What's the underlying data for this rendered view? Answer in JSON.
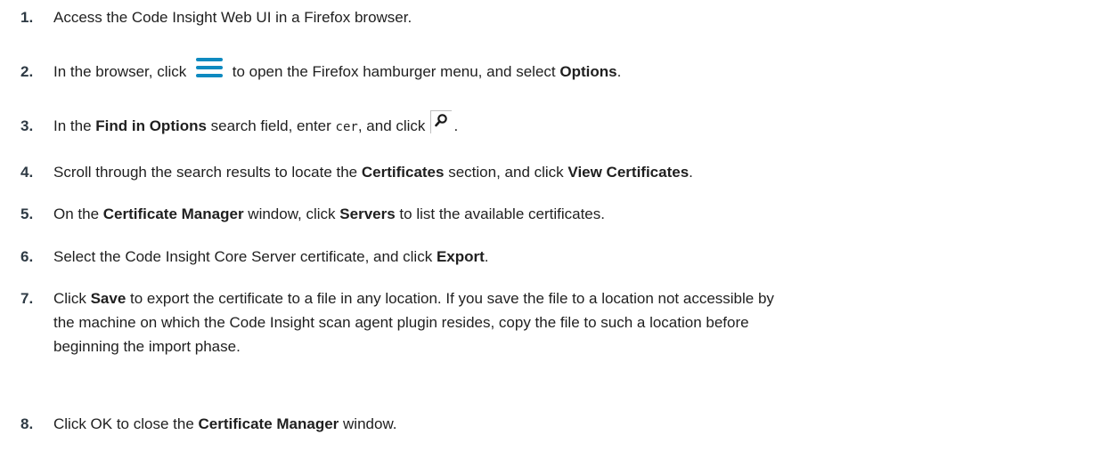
{
  "steps": [
    {
      "number": "1.",
      "parts": [
        "Access the Code Insight Web UI in a Firefox browser."
      ]
    },
    {
      "number": "2.",
      "parts": [
        "In the browser, click",
        "to open the Firefox hamburger menu, and select",
        "Options",
        "."
      ],
      "icon": "hamburger-menu-icon"
    },
    {
      "number": "3.",
      "parts": [
        "In the",
        "Find in Options",
        "search field, enter",
        "cer",
        ", and click",
        "."
      ],
      "icon": "search-icon"
    },
    {
      "number": "4.",
      "parts": [
        "Scroll through the search results to locate the",
        "Certificates",
        "section, and click",
        "View Certificates",
        "."
      ]
    },
    {
      "number": "5.",
      "parts": [
        "On the",
        "Certificate Manager",
        "window, click",
        "Servers",
        "to list the available certificates."
      ]
    },
    {
      "number": "6.",
      "parts": [
        "Select the Code Insight Core Server certificate, and click",
        "Export",
        "."
      ]
    },
    {
      "number": "7.",
      "parts": [
        "Click",
        "Save",
        "to export the certificate to a file in any location. If you save the file to a location not accessible by",
        "the machine on which the Code Insight scan agent plugin resides, copy the file to such a location before",
        "beginning the import phase."
      ]
    },
    {
      "number": "8.",
      "parts": [
        "Click OK to close the",
        "Certificate Manager",
        "window."
      ]
    }
  ],
  "colors": {
    "text": "#1f1f1f",
    "icon_accent": "#0e8ac0"
  }
}
